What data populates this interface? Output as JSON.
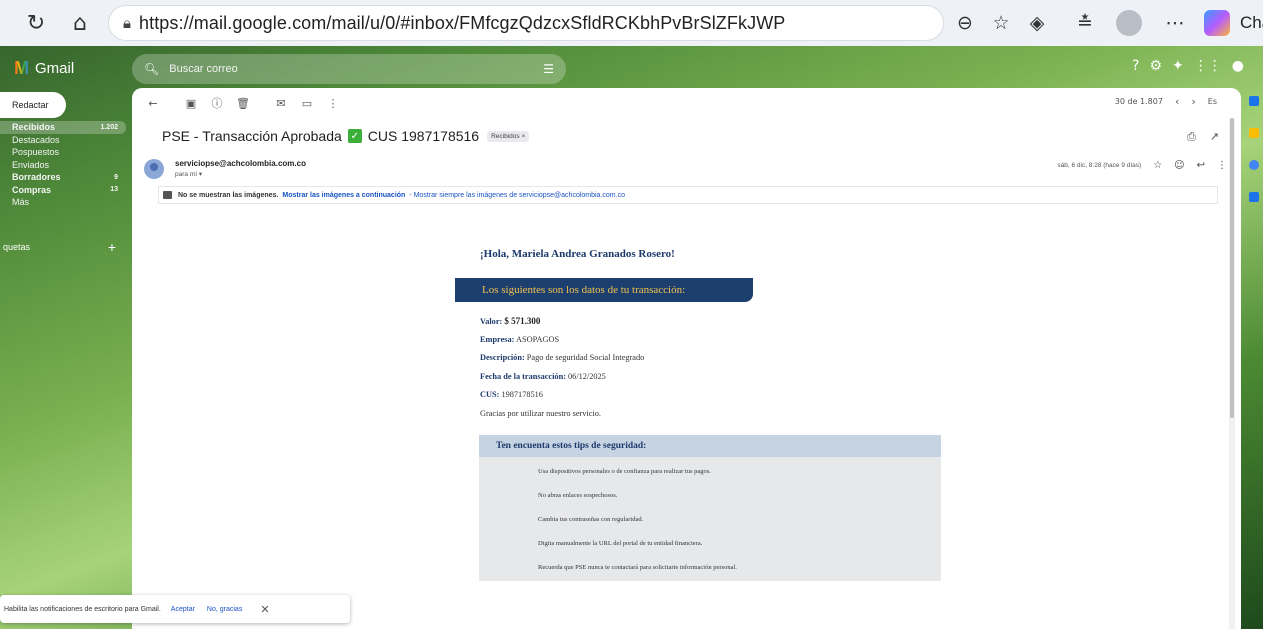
{
  "browser": {
    "url": "https://mail.google.com/mail/u/0/#inbox/FMfcgzQdzcxSfldRCKbhPvBrSlZFkJWP",
    "chat_label": "Cha"
  },
  "gmail": {
    "brand": "Gmail",
    "search_placeholder": "Buscar correo"
  },
  "nav": {
    "compose": "Redactar",
    "items": [
      {
        "label": "Recibidos",
        "count": "1.202"
      },
      {
        "label": "Destacados",
        "count": ""
      },
      {
        "label": "Pospuestos",
        "count": ""
      },
      {
        "label": "Enviados",
        "count": ""
      },
      {
        "label": "Borradores",
        "count": "9"
      },
      {
        "label": "Compras",
        "count": "13"
      },
      {
        "label": "Más",
        "count": ""
      }
    ],
    "labels_title": "quetas"
  },
  "toolbar": {
    "pagination": "30 de 1.807",
    "lang": "Es"
  },
  "message": {
    "subject": "PSE - Transacción Aprobada",
    "subject_cus": "CUS 1987178516",
    "inbox_chip": "Recibidos ×",
    "sender": "serviciopse@achcolombia.com.co",
    "to": "para mí ▾",
    "date": "sáb, 6 dic, 8:28 (hace 9 días)",
    "images_notice": "No se muestran las imágenes.",
    "show_images": "Mostrar las imágenes a continuación",
    "always_show": "- Mostrar siempre las imágenes de serviciopse@achcolombia.com.co"
  },
  "body": {
    "greeting": "¡Hola, Mariela Andrea Granados Rosero!",
    "banner": "Los siguientes son los datos de tu transacción:",
    "valor_label": "Valor:",
    "valor": "$ 571.300",
    "empresa_label": "Empresa:",
    "empresa": "ASOPAGOS",
    "descripcion_label": "Descripción:",
    "descripcion": "Pago de seguridad Social Integrado",
    "fecha_label": "Fecha de la transacción:",
    "fecha": "06/12/2025",
    "cus_label": "CUS:",
    "cus": "1987178516",
    "thanks": "Gracias por utilizar nuestro servicio.",
    "tips_title": "Ten encuenta estos tips de seguridad:",
    "tips": [
      "Usa dispositivos personales o de confianza para realizar tus pagos.",
      "No abras enlaces sospechosos.",
      "Cambia tus contraseñas con regularidad.",
      "Digita manualmente la URL del portal de tu entidad financiera.",
      "Recuerda que PSE nunca te contactará para solicitarte información personal."
    ]
  },
  "toast": {
    "text": "Habilita las notificaciones de escritorio para Gmail.",
    "accept": "Aceptar",
    "decline": "No, gracias"
  }
}
